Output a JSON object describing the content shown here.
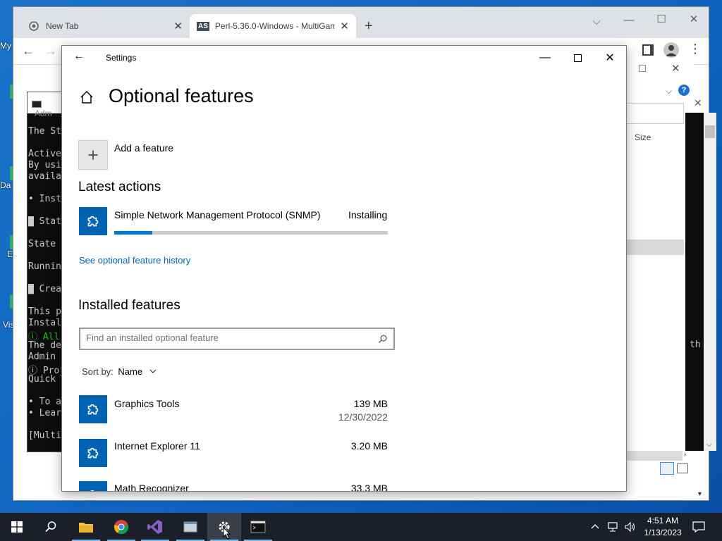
{
  "desktop": {
    "icon_labels": [
      "My",
      "Da",
      "E",
      "Vis"
    ]
  },
  "chrome": {
    "tabs": [
      {
        "label": "New Tab"
      },
      {
        "label": "Perl-5.36.0-Windows - MultiGam",
        "favicon": "AS"
      }
    ],
    "new_tab_label": "+"
  },
  "explorer": {
    "size_header": "Size"
  },
  "console": {
    "title": "Adm",
    "lines": [
      "The St",
      "",
      "Active",
      "By usi",
      "availa",
      "",
      "• Inst",
      "",
      "█ Stat",
      "",
      "State",
      "",
      "Runnin",
      "",
      "█ Crea",
      "",
      "This p",
      "Instal",
      "ⓘ All",
      "The de",
      " Admin",
      "ⓘ Proj",
      "Quick",
      "",
      "• To a",
      "• Lear",
      "",
      "[Multi"
    ],
    "right_text": "th"
  },
  "settings": {
    "window_title": "Settings",
    "page_title": "Optional features",
    "add_feature_label": "Add a feature",
    "latest_actions_heading": "Latest actions",
    "latest_action": {
      "name": "Simple Network Management Protocol (SNMP)",
      "status": "Installing",
      "progress": 0.14,
      "accent": "#0078d7"
    },
    "history_link": "See optional feature history",
    "installed_heading": "Installed features",
    "search_placeholder": "Find an installed optional feature",
    "sort_label": "Sort by:",
    "sort_value": "Name",
    "features": [
      {
        "name": "Graphics Tools",
        "size": "139 MB",
        "date": "12/30/2022"
      },
      {
        "name": "Internet Explorer 11",
        "size": "3.20 MB",
        "date": ""
      },
      {
        "name": "Math Recognizer",
        "size": "33.3 MB",
        "date": ""
      }
    ]
  },
  "taskbar": {
    "time": "4:51 AM",
    "date": "1/13/2023"
  }
}
